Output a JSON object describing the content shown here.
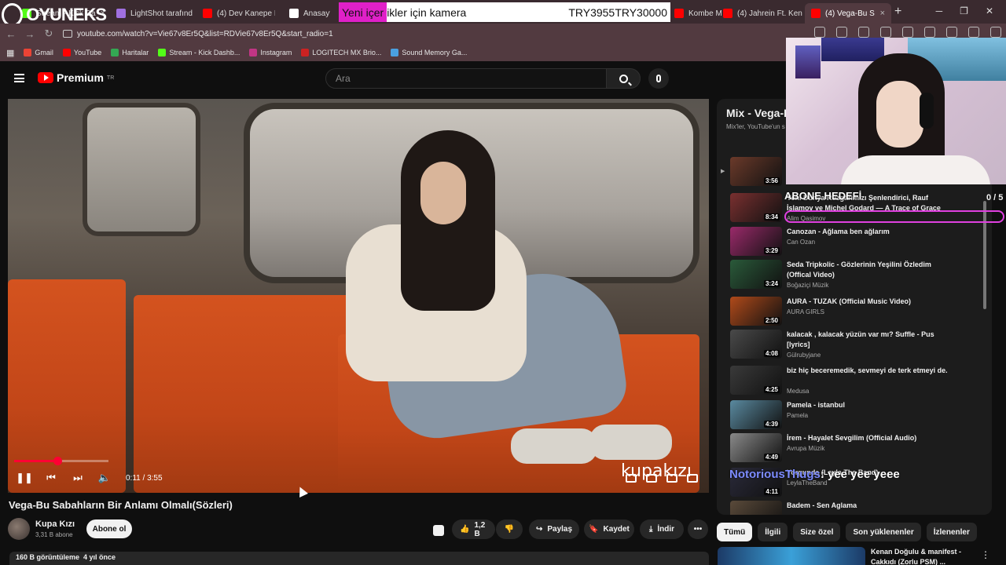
{
  "browser": {
    "tabs": [
      {
        "label": "Stream - Kick Da",
        "color": "#53fc18"
      },
      {
        "label": "LightShot tarafınd",
        "color": "#a070e0"
      },
      {
        "label": "(4) Dev Kanepe B",
        "color": "#ff0000"
      },
      {
        "label": "Anasayfa / X",
        "color": "#ffffff"
      },
      {
        "label": "Kombe M",
        "color": "#ff0000"
      },
      {
        "label": "(4) Jahrein Ft. Ken",
        "color": "#ff0000"
      },
      {
        "label": "(4) Vega-Bu S",
        "color": "#ff0000"
      }
    ],
    "url": "youtube.com/watch?v=Vie67v8Er5Q&list=RDVie67v8Er5Q&start_radio=1",
    "bookmarks": [
      {
        "label": "Gmail",
        "color": "#ea4335"
      },
      {
        "label": "YouTube",
        "color": "#ff0000"
      },
      {
        "label": "Haritalar",
        "color": "#34a853"
      },
      {
        "label": "Stream - Kick Dashb...",
        "color": "#53fc18"
      },
      {
        "label": "Instagram",
        "color": "#c13584"
      },
      {
        "label": "LOGITECH MX Brio...",
        "color": "#cc2222"
      },
      {
        "label": "Sound Memory Ga...",
        "color": "#4aa0e0"
      }
    ]
  },
  "stream_overlay": {
    "brand": "OYUNEKS",
    "ticker_highlight": "Yeni içer",
    "ticker_rest": "ikler için kamera",
    "ticker_value1": "TRY3955",
    "ticker_value2": "TRY30000",
    "goal_label": "ABONE HEDEFİ",
    "goal_counter": "0 / 5",
    "chat_nick": "NotoriousThugs",
    "chat_message": ": yee yee yeee"
  },
  "header": {
    "logo_text": "Premium",
    "region": "TR",
    "search_placeholder": "Ara"
  },
  "player": {
    "watermark": "kupakızı",
    "current_time": "0:11",
    "duration": "3:55",
    "progress_fraction": 0.047
  },
  "video": {
    "title": "Vega-Bu Sabahların Bir Anlamı Olmalı(Sözleri)",
    "channel": "Kupa Kızı",
    "subscribers": "3,31 B abone",
    "subscribe_label": "Abone ol",
    "likes": "1,2 B",
    "share_label": "Paylaş",
    "save_label": "Kaydet",
    "download_label": "İndir",
    "views": "160 B görüntüleme",
    "age": "4 yıl önce"
  },
  "playlist": {
    "title": "Mix - Vega-B",
    "subtitle": "Mix'ler, YouTube'un s",
    "playing_marker": "▶",
    "items": [
      {
        "title": "",
        "channel": "",
        "duration": "3:56",
        "thumb": "#6b3a2a"
      },
      {
        "title": "Yeni Dünya Rüzgârımızı Şenlendirici, Rauf İslamov ve Michel Godard — A Trace of Grace",
        "channel": "Alim Qasimov",
        "duration": "8:34",
        "thumb": "#7a3030"
      },
      {
        "title": "Canozan - Ağlama ben ağlarım",
        "channel": "Can Ozan",
        "duration": "3:29",
        "thumb": "#9a2a6a"
      },
      {
        "title": "Seda Tripkolic - Gözlerinin Yeşilini Özledim (Offical Video)",
        "channel": "Boğaziçi Müzik",
        "duration": "3:24",
        "thumb": "#2a5a3a"
      },
      {
        "title": "AURA - TUZAK (Official Music Video)",
        "channel": "AURA GIRLS",
        "duration": "2:50",
        "thumb": "#b04a1a"
      },
      {
        "title": "kalacak , kalacak yüzün var mı? Suffle - Pus [lyrics]",
        "channel": "Gülrubyjane",
        "duration": "4:08",
        "thumb": "#4a4a4a"
      },
      {
        "title": "biz hiç beceremedik, sevmeyi de terk etmeyi de.",
        "channel": "Medusa",
        "duration": "4:25",
        "thumb": "#3a3a3a"
      },
      {
        "title": "Pamela - istanbul",
        "channel": "Pamela",
        "duration": "4:39",
        "thumb": "#5a8aa0"
      },
      {
        "title": "İrem - Hayalet Sevgilim (Official Audio)",
        "channel": "Avrupa Müzik",
        "duration": "4:49",
        "thumb": "#8a8a8a"
      },
      {
        "title": "Yorgunda (Leyla The Band)",
        "channel": "LeylaTheBand",
        "duration": "4:11",
        "thumb": "#2a2a3a"
      },
      {
        "title": "Badem - Sen Aglama",
        "channel": "",
        "duration": "",
        "thumb": "#5a4a3a"
      }
    ]
  },
  "chips": [
    "Tümü",
    "İlgili",
    "Size özel",
    "Son yüklenenler",
    "İzlenenler"
  ],
  "next_up": {
    "title": "Kenan Doğulu & manifest - Cakkıdı (Zorlu PSM) ..."
  },
  "colors": {
    "accent": "#ff0033",
    "background": "#0f0f0f",
    "chrome": "#523a40"
  }
}
